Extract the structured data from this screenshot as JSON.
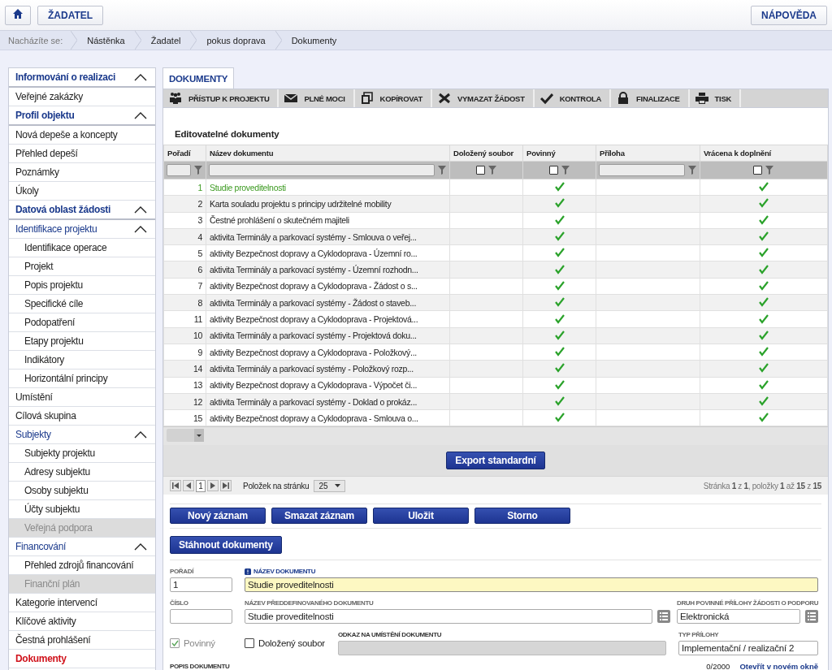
{
  "top_bar": {
    "home": {
      "selected": false
    },
    "applicant": "ŽADATEL",
    "help": "NÁPOVĚDA"
  },
  "breadcrumb": {
    "label": "Nacházíte se:",
    "items": [
      "Nástěnka",
      "Žadatel",
      "pokus doprava",
      "Dokumenty"
    ]
  },
  "sidebar": {
    "items": [
      {
        "label": "Informování o realizaci",
        "kind": "group",
        "expanded": true,
        "selected": false,
        "disabled": false,
        "children": [
          {
            "label": "Veřejné zakázky",
            "kind": "link",
            "selected": false,
            "disabled": false
          }
        ]
      },
      {
        "label": "Profil objektu",
        "kind": "group",
        "expanded": true,
        "selected": false,
        "disabled": false,
        "children": [
          {
            "label": "Nová depeše a koncepty",
            "kind": "link",
            "selected": false,
            "disabled": false
          },
          {
            "label": "Přehled depeší",
            "kind": "link",
            "selected": false,
            "disabled": false
          },
          {
            "label": "Poznámky",
            "kind": "link",
            "selected": false,
            "disabled": false
          },
          {
            "label": "Úkoly",
            "kind": "link",
            "selected": false,
            "disabled": false
          }
        ]
      },
      {
        "label": "Datová oblast žádosti",
        "kind": "group",
        "expanded": true,
        "selected": false,
        "disabled": false,
        "children": [
          {
            "label": "Identifikace projektu",
            "kind": "group",
            "expanded": true,
            "selected": false,
            "disabled": false,
            "children": [
              {
                "label": "Identifikace operace",
                "kind": "link",
                "selected": false,
                "disabled": false
              },
              {
                "label": "Projekt",
                "kind": "link",
                "selected": false,
                "disabled": false
              },
              {
                "label": "Popis projektu",
                "kind": "link",
                "selected": false,
                "disabled": false
              },
              {
                "label": "Specifické cíle",
                "kind": "link",
                "selected": false,
                "disabled": false
              },
              {
                "label": "Podopatření",
                "kind": "link",
                "selected": false,
                "disabled": false
              },
              {
                "label": "Etapy projektu",
                "kind": "link",
                "selected": false,
                "disabled": false
              },
              {
                "label": "Indikátory",
                "kind": "link",
                "selected": false,
                "disabled": false
              },
              {
                "label": "Horizontální principy",
                "kind": "link",
                "selected": false,
                "disabled": false
              }
            ]
          },
          {
            "label": "Umístění",
            "kind": "link",
            "selected": false,
            "disabled": false
          },
          {
            "label": "Cílová skupina",
            "kind": "link",
            "selected": false,
            "disabled": false
          },
          {
            "label": "Subjekty",
            "kind": "group",
            "expanded": true,
            "selected": false,
            "disabled": false,
            "children": [
              {
                "label": "Subjekty projektu",
                "kind": "link",
                "selected": false,
                "disabled": false
              },
              {
                "label": "Adresy subjektu",
                "kind": "link",
                "selected": false,
                "disabled": false
              },
              {
                "label": "Osoby subjektu",
                "kind": "link",
                "selected": false,
                "disabled": false
              },
              {
                "label": "Účty subjektu",
                "kind": "link",
                "selected": false,
                "disabled": false
              },
              {
                "label": "Veřejná podpora",
                "kind": "link",
                "selected": false,
                "disabled": true
              }
            ]
          },
          {
            "label": "Financování",
            "kind": "group",
            "expanded": true,
            "selected": false,
            "disabled": false,
            "children": [
              {
                "label": "Přehled zdrojů financování",
                "kind": "link",
                "selected": false,
                "disabled": false
              },
              {
                "label": "Finanční plán",
                "kind": "link",
                "selected": false,
                "disabled": true
              }
            ]
          },
          {
            "label": "Kategorie intervencí",
            "kind": "link",
            "selected": false,
            "disabled": false
          },
          {
            "label": "Klíčové aktivity",
            "kind": "link",
            "selected": false,
            "disabled": false
          },
          {
            "label": "Čestná prohlášení",
            "kind": "link",
            "selected": false,
            "disabled": false
          },
          {
            "label": "Dokumenty",
            "kind": "link",
            "selected": true,
            "disabled": false
          }
        ]
      }
    ]
  },
  "tabs": [
    {
      "label": "DOKUMENTY",
      "selected": true
    }
  ],
  "toolbar": [
    {
      "label": "PŘÍSTUP K PROJEKTU",
      "kind": "people"
    },
    {
      "label": "PLNÉ MOCI",
      "kind": "envelope"
    },
    {
      "label": "KOPÍROVAT",
      "kind": "copy"
    },
    {
      "label": "VYMAZAT ŽÁDOST",
      "kind": "delete"
    },
    {
      "label": "KONTROLA",
      "kind": "check"
    },
    {
      "label": "FINALIZACE",
      "kind": "lock"
    },
    {
      "label": "TISK",
      "kind": "print"
    }
  ],
  "section_title": "Editovatelné dokumenty",
  "table": {
    "columns": [
      {
        "label": "Pořadí",
        "kind": "text"
      },
      {
        "label": "Název dokumentu",
        "kind": "text"
      },
      {
        "label": "Doložený soubor",
        "kind": "checkbox",
        "checked": false
      },
      {
        "label": "Povinný",
        "kind": "checkbox",
        "checked": false
      },
      {
        "label": "Příloha",
        "kind": "text"
      },
      {
        "label": "Vrácena k doplnění",
        "kind": "checkbox",
        "checked": false
      }
    ],
    "rows": [
      {
        "order": "1",
        "name": "Studie proveditelnosti",
        "required": true,
        "returned": true,
        "selected": true
      },
      {
        "order": "2",
        "name": "Karta souladu projektu s principy udržitelné mobility",
        "required": true,
        "returned": true,
        "selected": false
      },
      {
        "order": "3",
        "name": "Čestné prohlášení o skutečném majiteli",
        "required": true,
        "returned": true,
        "selected": false
      },
      {
        "order": "4",
        "name": "aktivita Terminály a parkovací systémy - Smlouva o veřej...",
        "required": true,
        "returned": true,
        "selected": false
      },
      {
        "order": "5",
        "name": "aktivity Bezpečnost dopravy a Cyklodoprava - Územní ro...",
        "required": true,
        "returned": true,
        "selected": false
      },
      {
        "order": "6",
        "name": "aktivita Terminály a parkovací systémy - Územní rozhodn...",
        "required": true,
        "returned": true,
        "selected": false
      },
      {
        "order": "7",
        "name": "aktivity Bezpečnost dopravy a Cyklodoprava - Žádost o s...",
        "required": true,
        "returned": true,
        "selected": false
      },
      {
        "order": "8",
        "name": "aktivita Terminály a parkovací systémy - Žádost o staveb...",
        "required": true,
        "returned": true,
        "selected": false
      },
      {
        "order": "11",
        "name": "aktivity Bezpečnost dopravy a Cyklodoprava - Projektová...",
        "required": true,
        "returned": true,
        "selected": false
      },
      {
        "order": "10",
        "name": "aktivita Terminály a parkovací systémy - Projektová doku...",
        "required": true,
        "returned": true,
        "selected": false
      },
      {
        "order": "9",
        "name": "aktivity Bezpečnost dopravy a Cyklodoprava - Položkový...",
        "required": true,
        "returned": true,
        "selected": false
      },
      {
        "order": "14",
        "name": "aktivita Terminály a parkovací systémy - Položkový rozp...",
        "required": true,
        "returned": true,
        "selected": false
      },
      {
        "order": "13",
        "name": "aktivity Bezpečnost dopravy a Cyklodoprava - Výpočet či...",
        "required": true,
        "returned": true,
        "selected": false
      },
      {
        "order": "12",
        "name": "aktivita Terminály a parkovací systémy - Doklad o prokáz...",
        "required": true,
        "returned": true,
        "selected": false
      },
      {
        "order": "15",
        "name": "aktivity Bezpečnost dopravy a Cyklodoprava - Smlouva o...",
        "required": true,
        "returned": true,
        "selected": false
      }
    ]
  },
  "export_button": "Export standardní",
  "pager": {
    "page": "1",
    "per_page_label": "Položek na stránku",
    "per_page": "25",
    "status": "Stránka **1** z **1**, položky **1** až **15** z **15**"
  },
  "actions": [
    "Nový záznam",
    "Smazat záznam",
    "Uložit",
    "Storno"
  ],
  "download_button": "Stáhnout dokumenty",
  "form": {
    "order": {
      "label": "POŘADÍ",
      "value": "1"
    },
    "name": {
      "label": "NÁZEV DOKUMENTU",
      "value": "Studie proveditelnosti",
      "required": true
    },
    "number": {
      "label": "ČÍSLO"
    },
    "predefined": {
      "label": "NÁZEV PŘEDDEFINOVANÉHO DOKUMENTU",
      "value": "Studie proveditelnosti"
    },
    "attachment_kind": {
      "label": "DRUH POVINNÉ PŘÍLOHY ŽÁDOSTI O PODPORU",
      "value": "Elektronická"
    },
    "mandatory": {
      "label": "Povinný",
      "checked": true,
      "disabled": true
    },
    "file_attached": {
      "label": "Doložený soubor",
      "checked": false,
      "disabled": false
    },
    "location": {
      "label": "ODKAZ NA UMÍSTĚNÍ DOKUMENTU",
      "disabled": true
    },
    "attachment_type": {
      "label": "TYP PŘÍLOHY",
      "value": "Implementační / realizační 2"
    },
    "description": {
      "label": "POPIS DOKUMENTU",
      "counter": "0/2000",
      "link": "Otevřít v novém okně"
    }
  }
}
